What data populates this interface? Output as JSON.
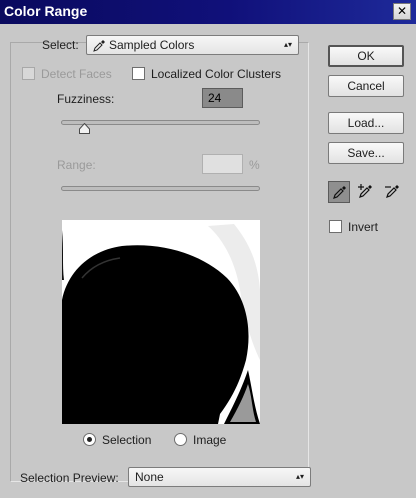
{
  "window": {
    "title": "Color Range",
    "close_glyph": "✕"
  },
  "select": {
    "label": "Select:",
    "value": "Sampled Colors",
    "icon": "eyedropper-icon"
  },
  "detect_faces": {
    "label": "Detect Faces",
    "checked": false,
    "enabled": false
  },
  "localized_clusters": {
    "label": "Localized Color Clusters",
    "checked": false
  },
  "fuzziness": {
    "label": "Fuzziness:",
    "value": "24",
    "slider_fraction": 0.12
  },
  "range": {
    "label": "Range:",
    "value": "",
    "unit": "%",
    "enabled": false
  },
  "view": {
    "selection_label": "Selection",
    "image_label": "Image",
    "selected": "selection"
  },
  "selection_preview": {
    "label": "Selection Preview:",
    "value": "None"
  },
  "buttons": {
    "ok": "OK",
    "cancel": "Cancel",
    "load": "Load...",
    "save": "Save..."
  },
  "tools": [
    "eyedropper-icon",
    "eyedropper-plus-icon",
    "eyedropper-minus-icon"
  ],
  "invert": {
    "label": "Invert",
    "checked": false
  }
}
